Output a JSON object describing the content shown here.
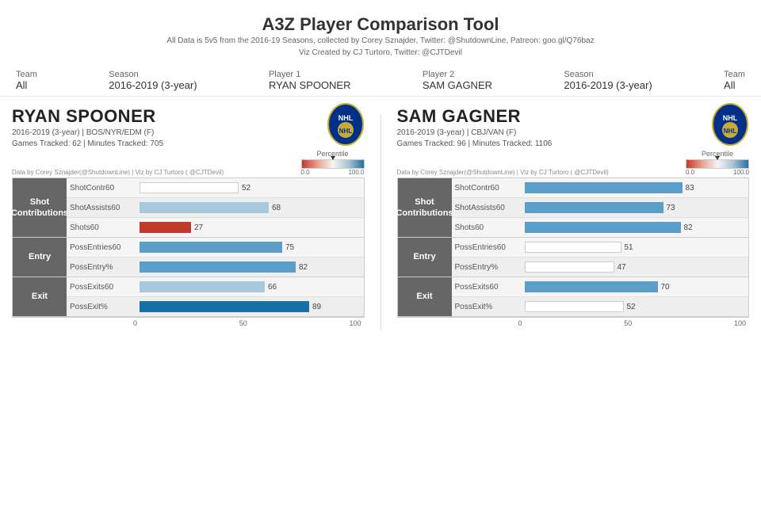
{
  "page": {
    "title": "A3Z Player Comparison Tool",
    "subtitle_line1": "All Data is 5v5 from the 2016-19 Seasons, collected by Corey Sznajder, Twitter: @ShutdownLine, Patreon: goo.gl/Q76baz",
    "subtitle_line2": "Viz Created by CJ Turtoro, Twitter: @CJTDevil"
  },
  "controls": {
    "items": [
      {
        "label": "Team",
        "value": "All"
      },
      {
        "label": "Season",
        "value": "2016-2019 (3-year)"
      },
      {
        "label": "Player 1",
        "value": "RYAN SPOONER"
      },
      {
        "label": "Player 2",
        "value": "SAM GAGNER"
      },
      {
        "label": "Season",
        "value": "2016-2019 (3-year)"
      },
      {
        "label": "Team",
        "value": "All"
      }
    ]
  },
  "player1": {
    "name": "RYAN SPOONER",
    "season": "2016-2019 (3-year)",
    "team": "BOS/NYR/EDM (F)",
    "games": "62",
    "minutes": "705",
    "credit": "Data by Corey Sznajder(@ShutdownLine) | Viz by CJ Turtoro ( @CJTDevil)",
    "percentile_label": "Percentile",
    "legend_min": "0.0",
    "legend_max": "100.0",
    "categories": [
      {
        "name": "Shot\nContributions",
        "metrics": [
          {
            "label": "ShotContr60",
            "value": 52,
            "color": "white"
          },
          {
            "label": "ShotAssists60",
            "value": 68,
            "color": "blue-light"
          },
          {
            "label": "Shots60",
            "value": 27,
            "color": "red"
          }
        ]
      },
      {
        "name": "Entry",
        "metrics": [
          {
            "label": "PossEntries60",
            "value": 75,
            "color": "blue-mid"
          },
          {
            "label": "PossEntry%",
            "value": 82,
            "color": "blue-mid"
          }
        ]
      },
      {
        "name": "Exit",
        "metrics": [
          {
            "label": "PossExits60",
            "value": 66,
            "color": "blue-light"
          },
          {
            "label": "PossExit%",
            "value": 89,
            "color": "blue-dark"
          }
        ]
      }
    ],
    "x_axis": [
      "0",
      "50",
      "100"
    ]
  },
  "player2": {
    "name": "SAM GAGNER",
    "season": "2016-2019 (3-year)",
    "team": "CBJ/VAN (F)",
    "games": "96",
    "minutes": "1106",
    "credit": "Data by Corey Sznajder(@ShutdownLine) | Viz by CJ Turtoro ( @CJTDevil)",
    "percentile_label": "Percentile",
    "legend_min": "0.0",
    "legend_max": "100.0",
    "categories": [
      {
        "name": "Shot\nContributions",
        "metrics": [
          {
            "label": "ShotContr60",
            "value": 83,
            "color": "blue-mid"
          },
          {
            "label": "ShotAssists60",
            "value": 73,
            "color": "blue-mid"
          },
          {
            "label": "Shots60",
            "value": 82,
            "color": "blue-mid"
          }
        ]
      },
      {
        "name": "Entry",
        "metrics": [
          {
            "label": "PossEntries60",
            "value": 51,
            "color": "white"
          },
          {
            "label": "PossEntry%",
            "value": 47,
            "color": "white"
          }
        ]
      },
      {
        "name": "Exit",
        "metrics": [
          {
            "label": "PossExits60",
            "value": 70,
            "color": "blue-mid"
          },
          {
            "label": "PossExit%",
            "value": 52,
            "color": "white"
          }
        ]
      }
    ],
    "x_axis": [
      "0",
      "50",
      "100"
    ]
  }
}
